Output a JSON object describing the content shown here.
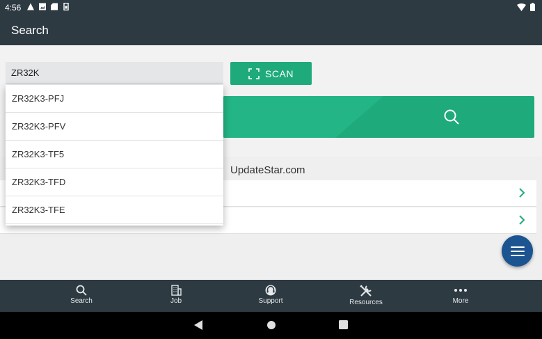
{
  "status_bar": {
    "time": "4:56",
    "left_icons": [
      "warning-icon",
      "image-icon",
      "sd-card-icon",
      "sim-icon"
    ],
    "right_icons": [
      "wifi-icon",
      "battery-icon"
    ]
  },
  "app_bar": {
    "title": "Search"
  },
  "search": {
    "value": "ZR32K",
    "scan_label": "SCAN"
  },
  "dropdown": {
    "items": [
      "ZR32K3-PFJ",
      "ZR32K3-PFV",
      "ZR32K3-TF5",
      "ZR32K3-TFD",
      "ZR32K3-TFE"
    ]
  },
  "results": {
    "header": "UpdateStar.com"
  },
  "bottom_nav": {
    "items": [
      {
        "label": "Search",
        "icon": "search-icon"
      },
      {
        "label": "Job",
        "icon": "building-icon"
      },
      {
        "label": "Support",
        "icon": "headset-icon"
      },
      {
        "label": "Resources",
        "icon": "tools-icon"
      },
      {
        "label": "More",
        "icon": "more-dots-icon"
      }
    ]
  },
  "colors": {
    "app_bar": "#2d3a42",
    "accent_green": "#1faa7c",
    "fab_blue": "#1c5491"
  }
}
